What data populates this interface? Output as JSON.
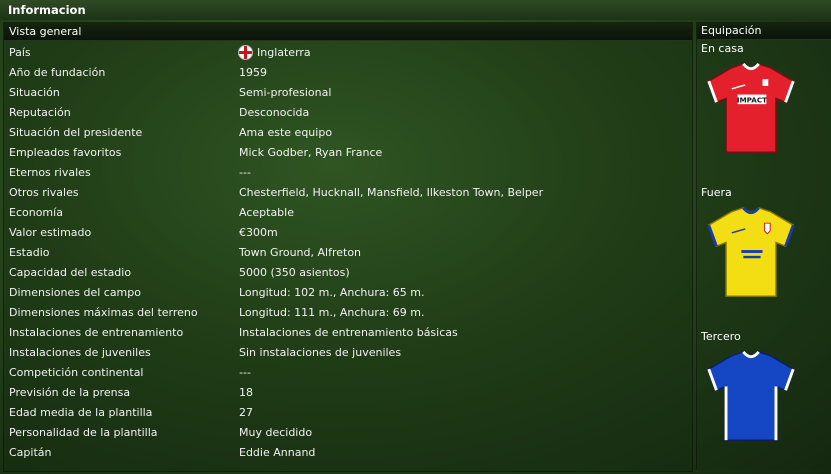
{
  "header": {
    "title": "Informacion"
  },
  "general": {
    "heading": "Vista general",
    "rows": [
      {
        "label": "País",
        "value": "Inglaterra"
      },
      {
        "label": "Año de fundación",
        "value": "1959"
      },
      {
        "label": "Situación",
        "value": "Semi-profesional"
      },
      {
        "label": "Reputación",
        "value": "Desconocida"
      },
      {
        "label": "Situación del presidente",
        "value": "Ama este equipo"
      },
      {
        "label": "Empleados favoritos",
        "value": "Mick Godber, Ryan France"
      },
      {
        "label": "Eternos rivales",
        "value": "---"
      },
      {
        "label": "Otros rivales",
        "value": "Chesterfield, Hucknall, Mansfield, Ilkeston Town, Belper"
      },
      {
        "label": "Economía",
        "value": "Aceptable"
      },
      {
        "label": "Valor estimado",
        "value": "€300m"
      },
      {
        "label": "Estadio",
        "value": "Town Ground, Alfreton"
      },
      {
        "label": "Capacidad del estadio",
        "value": "5000 (350 asientos)"
      },
      {
        "label": "Dimensiones del campo",
        "value": "Longitud: 102 m., Anchura: 65 m."
      },
      {
        "label": "Dimensiones máximas del terreno",
        "value": "Longitud: 111 m., Anchura: 69 m."
      },
      {
        "label": "Instalaciones de entrenamiento",
        "value": "Instalaciones de entrenamiento básicas"
      },
      {
        "label": "Instalaciones de juveniles",
        "value": "Sin instalaciones de juveniles"
      },
      {
        "label": "Competición continental",
        "value": "---"
      },
      {
        "label": "Previsión de la prensa",
        "value": "18"
      },
      {
        "label": "Edad media de la plantilla",
        "value": "27"
      },
      {
        "label": "Personalidad de la plantilla",
        "value": "Muy decidido"
      },
      {
        "label": "Capitán",
        "value": "Eddie Annand"
      }
    ]
  },
  "kits": {
    "heading": "Equipación",
    "home": {
      "label": "En casa",
      "color": "#e3202c",
      "sponsor": "IMPACT"
    },
    "away": {
      "label": "Fuera",
      "color": "#f3de14"
    },
    "third": {
      "label": "Tercero",
      "color": "#1546c4"
    }
  },
  "colors": {
    "accent_dark": "#0b140a",
    "pitch_green": "#3f6e2e",
    "england_red": "#cc1122"
  },
  "icons": {
    "country_flag": "england-flag-icon"
  }
}
